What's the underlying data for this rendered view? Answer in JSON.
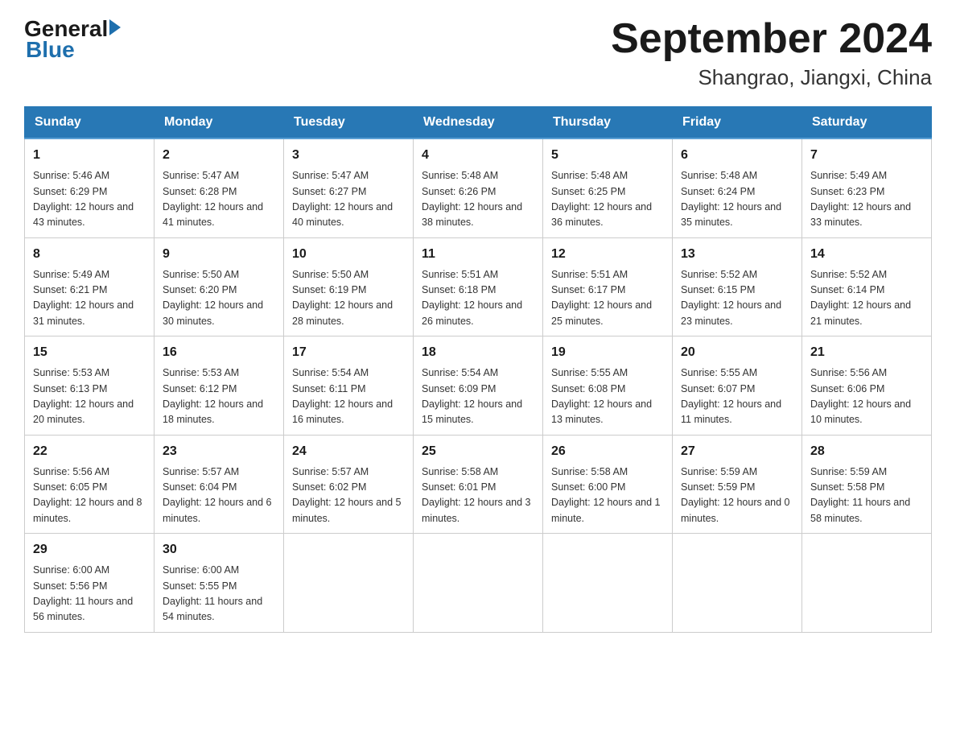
{
  "header": {
    "logo_general": "General",
    "logo_blue": "Blue",
    "title": "September 2024",
    "subtitle": "Shangrao, Jiangxi, China"
  },
  "days_of_week": [
    "Sunday",
    "Monday",
    "Tuesday",
    "Wednesday",
    "Thursday",
    "Friday",
    "Saturday"
  ],
  "weeks": [
    [
      {
        "day": "1",
        "sunrise": "5:46 AM",
        "sunset": "6:29 PM",
        "daylight": "12 hours and 43 minutes."
      },
      {
        "day": "2",
        "sunrise": "5:47 AM",
        "sunset": "6:28 PM",
        "daylight": "12 hours and 41 minutes."
      },
      {
        "day": "3",
        "sunrise": "5:47 AM",
        "sunset": "6:27 PM",
        "daylight": "12 hours and 40 minutes."
      },
      {
        "day": "4",
        "sunrise": "5:48 AM",
        "sunset": "6:26 PM",
        "daylight": "12 hours and 38 minutes."
      },
      {
        "day": "5",
        "sunrise": "5:48 AM",
        "sunset": "6:25 PM",
        "daylight": "12 hours and 36 minutes."
      },
      {
        "day": "6",
        "sunrise": "5:48 AM",
        "sunset": "6:24 PM",
        "daylight": "12 hours and 35 minutes."
      },
      {
        "day": "7",
        "sunrise": "5:49 AM",
        "sunset": "6:23 PM",
        "daylight": "12 hours and 33 minutes."
      }
    ],
    [
      {
        "day": "8",
        "sunrise": "5:49 AM",
        "sunset": "6:21 PM",
        "daylight": "12 hours and 31 minutes."
      },
      {
        "day": "9",
        "sunrise": "5:50 AM",
        "sunset": "6:20 PM",
        "daylight": "12 hours and 30 minutes."
      },
      {
        "day": "10",
        "sunrise": "5:50 AM",
        "sunset": "6:19 PM",
        "daylight": "12 hours and 28 minutes."
      },
      {
        "day": "11",
        "sunrise": "5:51 AM",
        "sunset": "6:18 PM",
        "daylight": "12 hours and 26 minutes."
      },
      {
        "day": "12",
        "sunrise": "5:51 AM",
        "sunset": "6:17 PM",
        "daylight": "12 hours and 25 minutes."
      },
      {
        "day": "13",
        "sunrise": "5:52 AM",
        "sunset": "6:15 PM",
        "daylight": "12 hours and 23 minutes."
      },
      {
        "day": "14",
        "sunrise": "5:52 AM",
        "sunset": "6:14 PM",
        "daylight": "12 hours and 21 minutes."
      }
    ],
    [
      {
        "day": "15",
        "sunrise": "5:53 AM",
        "sunset": "6:13 PM",
        "daylight": "12 hours and 20 minutes."
      },
      {
        "day": "16",
        "sunrise": "5:53 AM",
        "sunset": "6:12 PM",
        "daylight": "12 hours and 18 minutes."
      },
      {
        "day": "17",
        "sunrise": "5:54 AM",
        "sunset": "6:11 PM",
        "daylight": "12 hours and 16 minutes."
      },
      {
        "day": "18",
        "sunrise": "5:54 AM",
        "sunset": "6:09 PM",
        "daylight": "12 hours and 15 minutes."
      },
      {
        "day": "19",
        "sunrise": "5:55 AM",
        "sunset": "6:08 PM",
        "daylight": "12 hours and 13 minutes."
      },
      {
        "day": "20",
        "sunrise": "5:55 AM",
        "sunset": "6:07 PM",
        "daylight": "12 hours and 11 minutes."
      },
      {
        "day": "21",
        "sunrise": "5:56 AM",
        "sunset": "6:06 PM",
        "daylight": "12 hours and 10 minutes."
      }
    ],
    [
      {
        "day": "22",
        "sunrise": "5:56 AM",
        "sunset": "6:05 PM",
        "daylight": "12 hours and 8 minutes."
      },
      {
        "day": "23",
        "sunrise": "5:57 AM",
        "sunset": "6:04 PM",
        "daylight": "12 hours and 6 minutes."
      },
      {
        "day": "24",
        "sunrise": "5:57 AM",
        "sunset": "6:02 PM",
        "daylight": "12 hours and 5 minutes."
      },
      {
        "day": "25",
        "sunrise": "5:58 AM",
        "sunset": "6:01 PM",
        "daylight": "12 hours and 3 minutes."
      },
      {
        "day": "26",
        "sunrise": "5:58 AM",
        "sunset": "6:00 PM",
        "daylight": "12 hours and 1 minute."
      },
      {
        "day": "27",
        "sunrise": "5:59 AM",
        "sunset": "5:59 PM",
        "daylight": "12 hours and 0 minutes."
      },
      {
        "day": "28",
        "sunrise": "5:59 AM",
        "sunset": "5:58 PM",
        "daylight": "11 hours and 58 minutes."
      }
    ],
    [
      {
        "day": "29",
        "sunrise": "6:00 AM",
        "sunset": "5:56 PM",
        "daylight": "11 hours and 56 minutes."
      },
      {
        "day": "30",
        "sunrise": "6:00 AM",
        "sunset": "5:55 PM",
        "daylight": "11 hours and 54 minutes."
      },
      null,
      null,
      null,
      null,
      null
    ]
  ]
}
